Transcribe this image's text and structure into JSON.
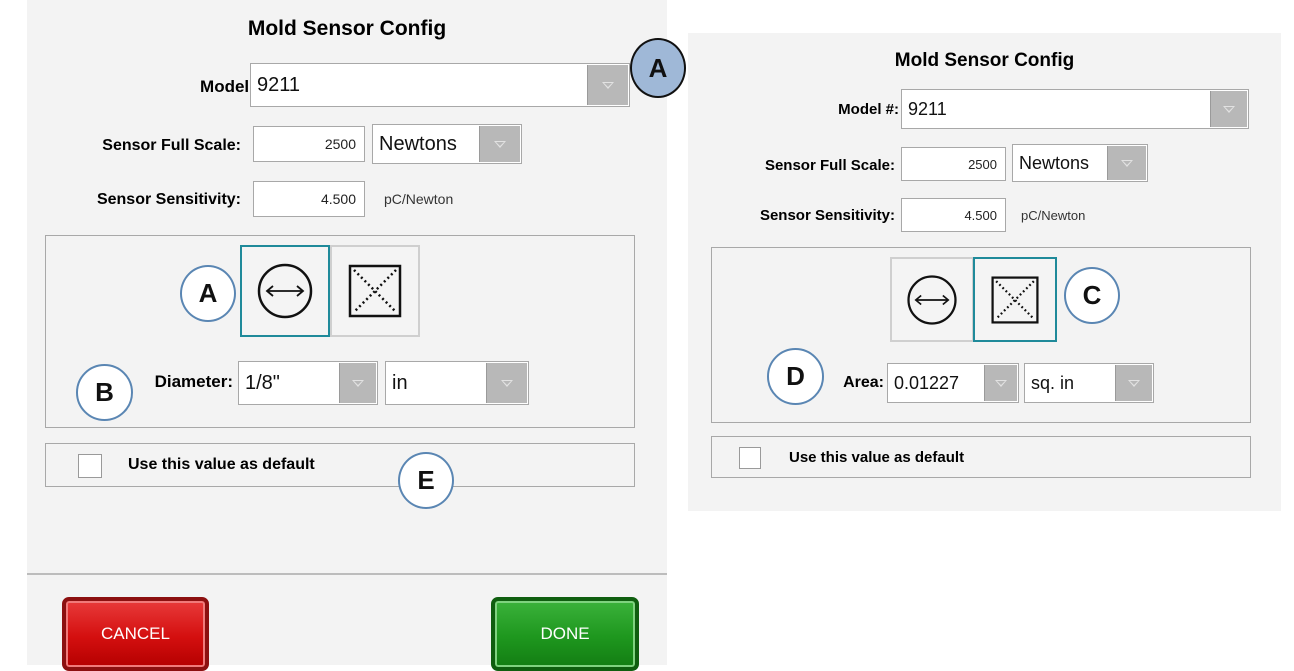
{
  "left": {
    "title": "Mold Sensor Config",
    "model_label": "Model #:",
    "model_value": "9211",
    "full_scale_label": "Sensor Full Scale:",
    "full_scale_value": "2500",
    "full_scale_unit": "Newtons",
    "sensitivity_label": "Sensor Sensitivity:",
    "sensitivity_value": "4.500",
    "sensitivity_unit": "pC/Newton",
    "dimension_label": "Diameter:",
    "dimension_value": "1/8\"",
    "dimension_unit": "in",
    "selected_shape": "diameter",
    "default_checkbox_label": "Use this value as default",
    "default_checked": false,
    "cancel_label": "CANCEL",
    "done_label": "DONE"
  },
  "right": {
    "title": "Mold Sensor Config",
    "model_label": "Model #:",
    "model_value": "9211",
    "full_scale_label": "Sensor Full Scale:",
    "full_scale_value": "2500",
    "full_scale_unit": "Newtons",
    "sensitivity_label": "Sensor Sensitivity:",
    "sensitivity_value": "4.500",
    "sensitivity_unit": "pC/Newton",
    "dimension_label": "Area:",
    "dimension_value": "0.01227",
    "dimension_unit": "sq. in",
    "selected_shape": "area",
    "default_checkbox_label": "Use this value as default",
    "default_checked": false
  },
  "callouts": {
    "model": "A",
    "shape": "A",
    "diameter": "B",
    "area_shape": "C",
    "area": "D",
    "default": "E"
  },
  "icons": {
    "diameter_shape": "circle-diameter-icon",
    "area_shape": "square-area-icon",
    "dropdown": "chevron-down-icon"
  },
  "colors": {
    "selected_border": "#1f8a9a",
    "cancel": "#d40f0f",
    "done": "#1e971e",
    "callout_fill": "#9fb8d7",
    "callout_border": "#5a86b3"
  }
}
